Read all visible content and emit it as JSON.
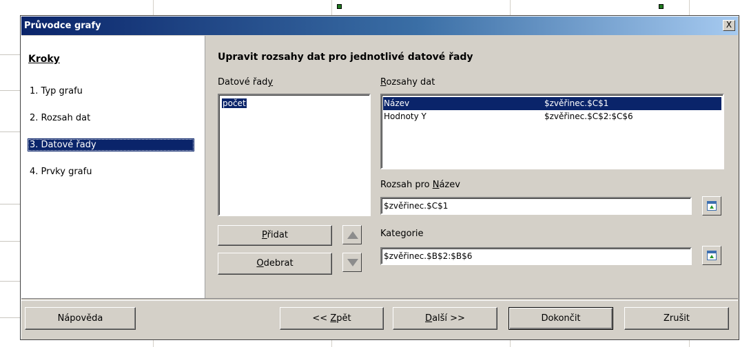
{
  "dialog": {
    "title": "Průvodce grafy",
    "close_label": "X"
  },
  "steps": {
    "title": "Kroky",
    "items": [
      {
        "label": "1. Typ grafu"
      },
      {
        "label": "2. Rozsah dat"
      },
      {
        "label": "3. Datové řady"
      },
      {
        "label": "4. Prvky grafu"
      }
    ],
    "active_index": 2
  },
  "main": {
    "heading": "Upravit rozsahy dat pro jednotlivé datové řady",
    "series_label": "Datové řady",
    "series_items": [
      "počet"
    ],
    "ranges_label": "Rozsahy dat",
    "ranges": [
      {
        "role": "Název",
        "range": "$zvěřinec.$C$1"
      },
      {
        "role": "Hodnoty Y",
        "range": "$zvěřinec.$C$2:$C$6"
      }
    ],
    "name_range_label": "Rozsah pro Název",
    "name_range_value": "$zvěřinec.$C$1",
    "category_label": "Kategorie",
    "category_value": "$zvěřinec.$B$2:$B$6",
    "add_label": "Přidat",
    "remove_label": "Odebrat"
  },
  "footer": {
    "help_label": "Nápověda",
    "back_label": "<< Zpět",
    "next_label": "Další >>",
    "finish_label": "Dokončit",
    "cancel_label": "Zrušit"
  },
  "icons": {
    "move_up": "arrow-up-icon",
    "move_down": "arrow-down-icon",
    "shrink": "shrink-dialog-icon"
  }
}
